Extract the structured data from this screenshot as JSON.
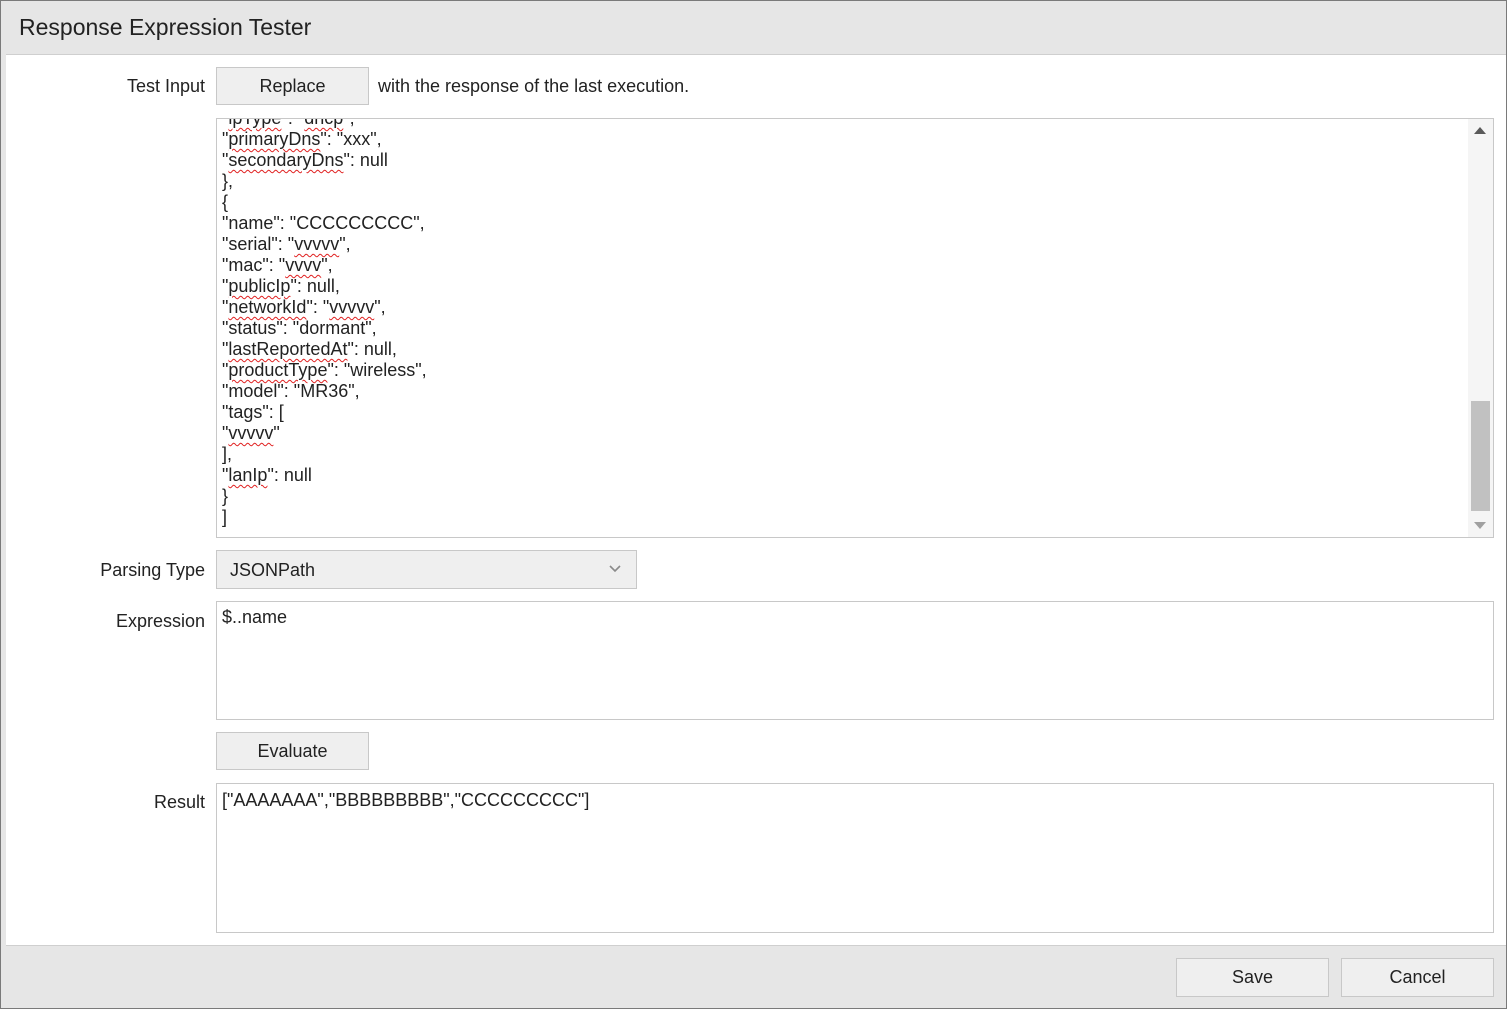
{
  "dialog": {
    "title": "Response Expression Tester"
  },
  "test_input": {
    "label": "Test Input",
    "replace_button": "Replace",
    "replace_suffix": "with the response of the last execution.",
    "lines": [
      [
        {
          "t": "\""
        },
        {
          "t": "ipType",
          "s": true
        },
        {
          "t": "\": \""
        },
        {
          "t": "dhcp",
          "s": true
        },
        {
          "t": "\","
        }
      ],
      [
        {
          "t": "\""
        },
        {
          "t": "primaryDns",
          "s": true
        },
        {
          "t": "\": \"xxx\","
        }
      ],
      [
        {
          "t": "\""
        },
        {
          "t": "secondaryDns",
          "s": true
        },
        {
          "t": "\": null"
        }
      ],
      [
        {
          "t": "},"
        }
      ],
      [
        {
          "t": "{"
        }
      ],
      [
        {
          "t": "\"name\": \"CCCCCCCCC\","
        }
      ],
      [
        {
          "t": "\"serial\": \""
        },
        {
          "t": "vvvvv",
          "s": true
        },
        {
          "t": "\","
        }
      ],
      [
        {
          "t": "\"mac\": \""
        },
        {
          "t": "vvvv",
          "s": true
        },
        {
          "t": "\","
        }
      ],
      [
        {
          "t": "\""
        },
        {
          "t": "publicIp",
          "s": true
        },
        {
          "t": "\": null,"
        }
      ],
      [
        {
          "t": "\""
        },
        {
          "t": "networkId",
          "s": true
        },
        {
          "t": "\": \""
        },
        {
          "t": "vvvvv",
          "s": true
        },
        {
          "t": "\","
        }
      ],
      [
        {
          "t": "\"status\": \"dormant\","
        }
      ],
      [
        {
          "t": "\""
        },
        {
          "t": "lastReportedAt",
          "s": true
        },
        {
          "t": "\": null,"
        }
      ],
      [
        {
          "t": "\""
        },
        {
          "t": "productType",
          "s": true
        },
        {
          "t": "\": \"wireless\","
        }
      ],
      [
        {
          "t": "\"model\": \"MR36\","
        }
      ],
      [
        {
          "t": "\"tags\": ["
        }
      ],
      [
        {
          "t": "\""
        },
        {
          "t": "vvvvv",
          "s": true
        },
        {
          "t": "\""
        }
      ],
      [
        {
          "t": "],"
        }
      ],
      [
        {
          "t": "\""
        },
        {
          "t": "lanIp",
          "s": true
        },
        {
          "t": "\": null"
        }
      ],
      [
        {
          "t": "}"
        }
      ],
      [
        {
          "t": "]"
        }
      ]
    ]
  },
  "parsing_type": {
    "label": "Parsing Type",
    "selected": "JSONPath"
  },
  "expression": {
    "label": "Expression",
    "value": "$..name"
  },
  "evaluate_button": "Evaluate",
  "result": {
    "label": "Result",
    "value": "[\"AAAAAAA\",\"BBBBBBBBB\",\"CCCCCCCCC\"]"
  },
  "footer": {
    "save_label": "Save",
    "cancel_label": "Cancel"
  }
}
